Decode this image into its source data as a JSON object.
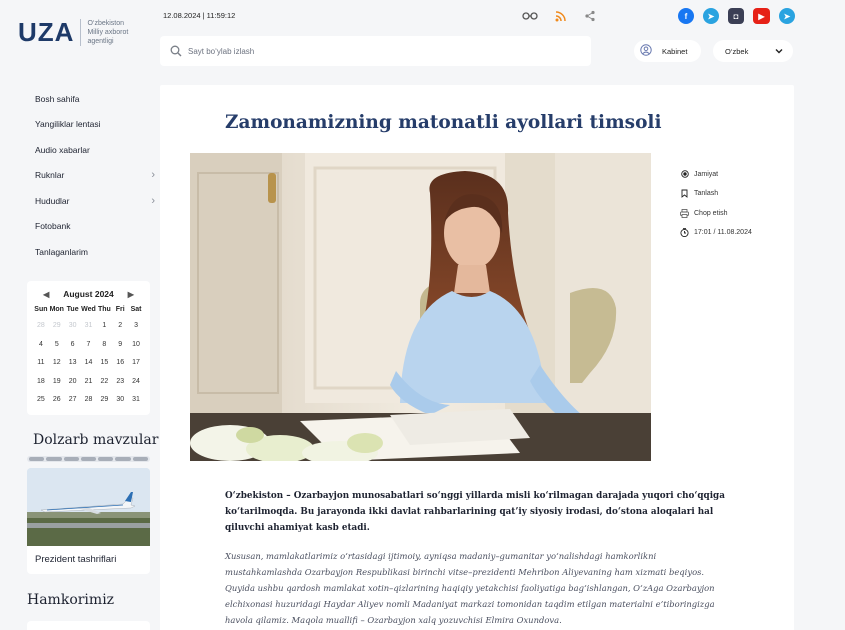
{
  "header": {
    "logo_text": "UZA",
    "logo_sub": [
      "O‘zbekiston",
      "Milliy axborot",
      "agentligi"
    ],
    "datetime": "12.08.2024 | 11:59:12",
    "search_placeholder": "Sayt bo‘ylab izlash",
    "cabinet_label": "Kabinet",
    "language": "O‘zbek",
    "social": [
      {
        "icon": "facebook-icon",
        "glyph": "f",
        "color": "#1877f2"
      },
      {
        "icon": "telegram-icon",
        "glyph": "➤",
        "color": "#2aa3e0"
      },
      {
        "icon": "instagram-icon",
        "glyph": "◘",
        "color": "#3b3f55"
      },
      {
        "icon": "youtube-icon",
        "glyph": "▶",
        "color": "#e62117"
      },
      {
        "icon": "telegram-channel-icon",
        "glyph": "➤",
        "color": "#2aa3e0"
      }
    ]
  },
  "sidebar": {
    "nav": [
      {
        "label": "Bosh sahifa",
        "chevron": false
      },
      {
        "label": "Yangiliklar lentasi",
        "chevron": false
      },
      {
        "label": "Audio xabarlar",
        "chevron": false
      },
      {
        "label": "Ruknlar",
        "chevron": true
      },
      {
        "label": "Hududlar",
        "chevron": true
      },
      {
        "label": "Fotobank",
        "chevron": false
      },
      {
        "label": "Tanlaganlarim",
        "chevron": false
      }
    ],
    "calendar": {
      "title": "August 2024",
      "weekdays": [
        "Sun",
        "Mon",
        "Tue",
        "Wed",
        "Thu",
        "Fri",
        "Sat"
      ],
      "days": [
        {
          "n": "28",
          "muted": true
        },
        {
          "n": "29",
          "muted": true
        },
        {
          "n": "30",
          "muted": true
        },
        {
          "n": "31",
          "muted": true
        },
        {
          "n": "1"
        },
        {
          "n": "2"
        },
        {
          "n": "3"
        },
        {
          "n": "4"
        },
        {
          "n": "5"
        },
        {
          "n": "6"
        },
        {
          "n": "7"
        },
        {
          "n": "8"
        },
        {
          "n": "9"
        },
        {
          "n": "10"
        },
        {
          "n": "11"
        },
        {
          "n": "12"
        },
        {
          "n": "13"
        },
        {
          "n": "14"
        },
        {
          "n": "15"
        },
        {
          "n": "16"
        },
        {
          "n": "17"
        },
        {
          "n": "18"
        },
        {
          "n": "19"
        },
        {
          "n": "20"
        },
        {
          "n": "21"
        },
        {
          "n": "22"
        },
        {
          "n": "23"
        },
        {
          "n": "24"
        },
        {
          "n": "25"
        },
        {
          "n": "26"
        },
        {
          "n": "27"
        },
        {
          "n": "28"
        },
        {
          "n": "29"
        },
        {
          "n": "30"
        },
        {
          "n": "31"
        }
      ]
    },
    "topics_title": "Dolzarb mavzular",
    "topic_card_label": "Prezident tashriflari",
    "partner_title": "Hamkorimiz"
  },
  "article": {
    "title": "Zamonamizning matonatli ayollari timsoli",
    "meta": {
      "category": "Jamiyat",
      "save": "Tanlash",
      "print": "Chop etish",
      "datetime": "17:01 / 11.08.2024"
    },
    "lead": "O‘zbekiston – Ozarbayjon munosabatlari so‘nggi yillarda misli ko‘rilmagan darajada yuqori cho‘qqiga ko‘tarilmoqda. Bu jarayonda ikki davlat rahbarlarining qat’iy siyosiy irodasi, do‘stona aloqalari hal qiluvchi ahamiyat kasb etadi.",
    "body": "Xususan, mamlakatlarimiz o‘rtasidagi ijtimoiy, ayniqsa madaniy–gumanitar yo‘nalishdagi hamkorlikni mustahkamlashda Ozarbayjon Respublikasi birinchi vitse–prezidenti Mehribon Aliyevaning ham xizmati beqiyos. Quyida ushbu qardosh mamlakat xotin–qizlarining haqiqiy yetakchisi faoliyatiga bag‘ishlangan, O‘zAga Ozarbayjon elchixonasi huzuridagi Haydar Aliyev nomli Madaniyat markazi tomonidan taqdim etilgan materialni e’tiboringizga havola qilamiz. Maqola muallifi – Ozarbayjon xalq yozuvchisi Elmira Oxundova."
  }
}
